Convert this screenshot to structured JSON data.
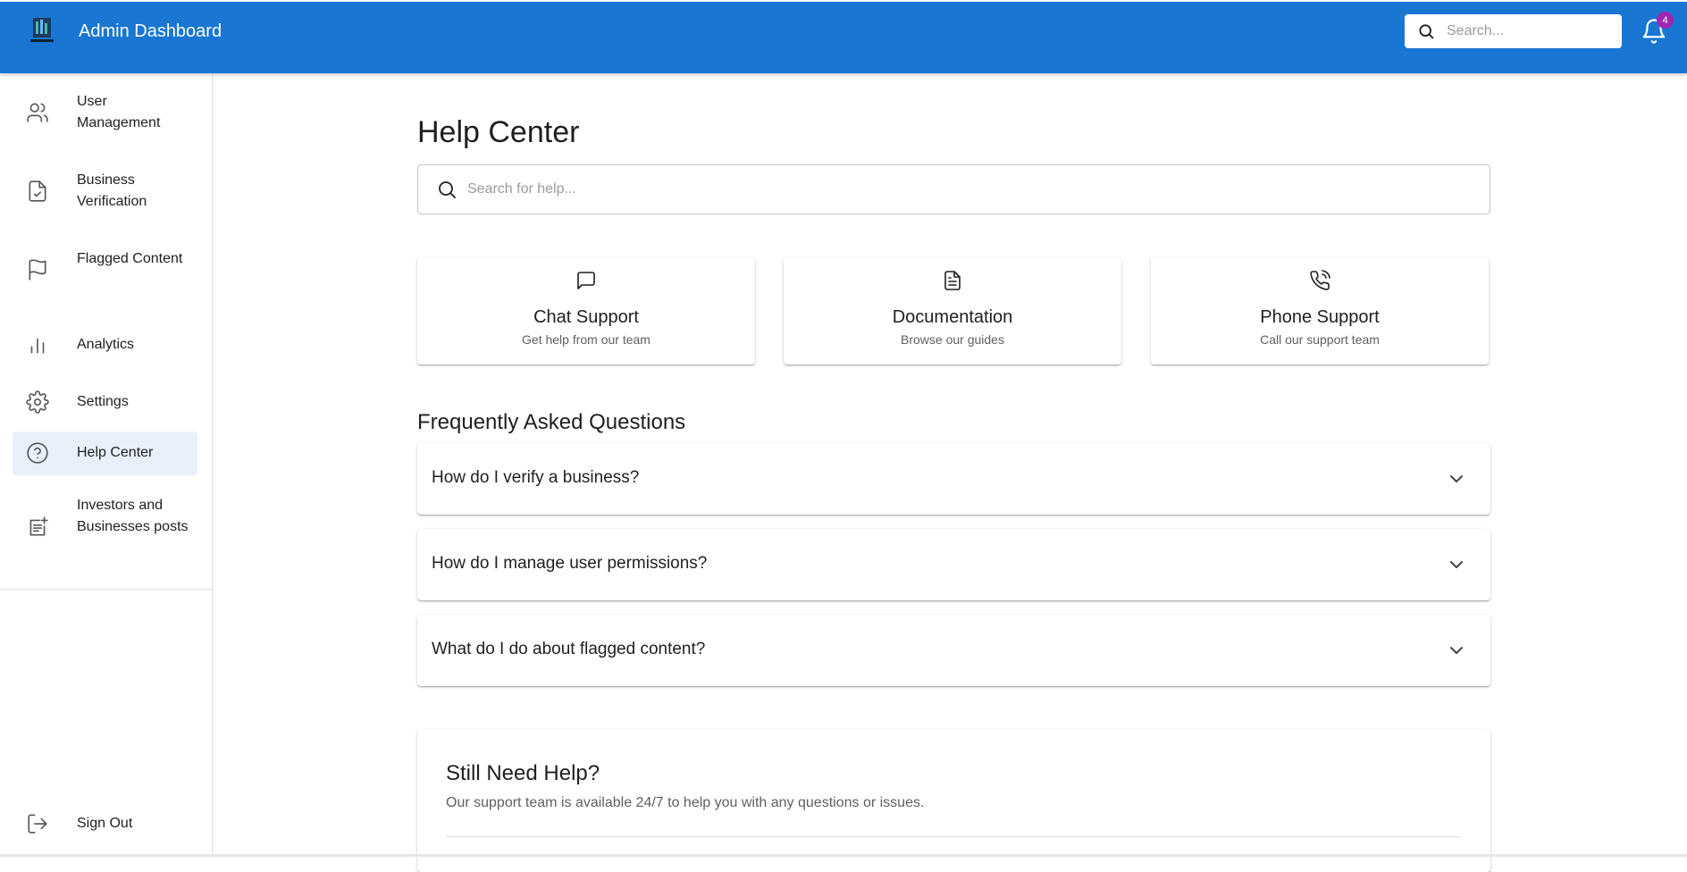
{
  "header": {
    "title": "Admin Dashboard",
    "logo_icon": "investment-logo-icon",
    "search_placeholder": "Search...",
    "notification_count": "4",
    "notification_icon": "bell-icon",
    "color": "#1976d2"
  },
  "sidebar": {
    "items": [
      {
        "label": "User Management",
        "icon": "users-icon"
      },
      {
        "label": "Business Verification",
        "icon": "file-check-icon"
      },
      {
        "label": "Flagged Content",
        "icon": "flag-icon"
      },
      {
        "label": "Analytics",
        "icon": "bar-chart-icon"
      },
      {
        "label": "Settings",
        "icon": "gear-icon"
      },
      {
        "label": "Help Center",
        "icon": "help-circle-icon",
        "active": true
      },
      {
        "label": "Investors and Businesses posts",
        "icon": "post-add-icon"
      }
    ],
    "sign_out": {
      "label": "Sign Out",
      "icon": "logout-icon"
    },
    "active_color": "#e8f1fb"
  },
  "main": {
    "title": "Help Center",
    "search_placeholder": "Search for help...",
    "cards": [
      {
        "title": "Chat Support",
        "subtitle": "Get help from our team",
        "icon": "chat-icon"
      },
      {
        "title": "Documentation",
        "subtitle": "Browse our guides",
        "icon": "document-icon"
      },
      {
        "title": "Phone Support",
        "subtitle": "Call our support team",
        "icon": "phone-icon"
      }
    ],
    "faq_heading": "Frequently Asked Questions",
    "faqs": [
      {
        "question": "How do I verify a business?"
      },
      {
        "question": "How do I manage user permissions?"
      },
      {
        "question": "What do I do about flagged content?"
      }
    ],
    "still_need_help": {
      "title": "Still Need Help?",
      "text": "Our support team is available 24/7 to help you with any questions or issues."
    }
  }
}
